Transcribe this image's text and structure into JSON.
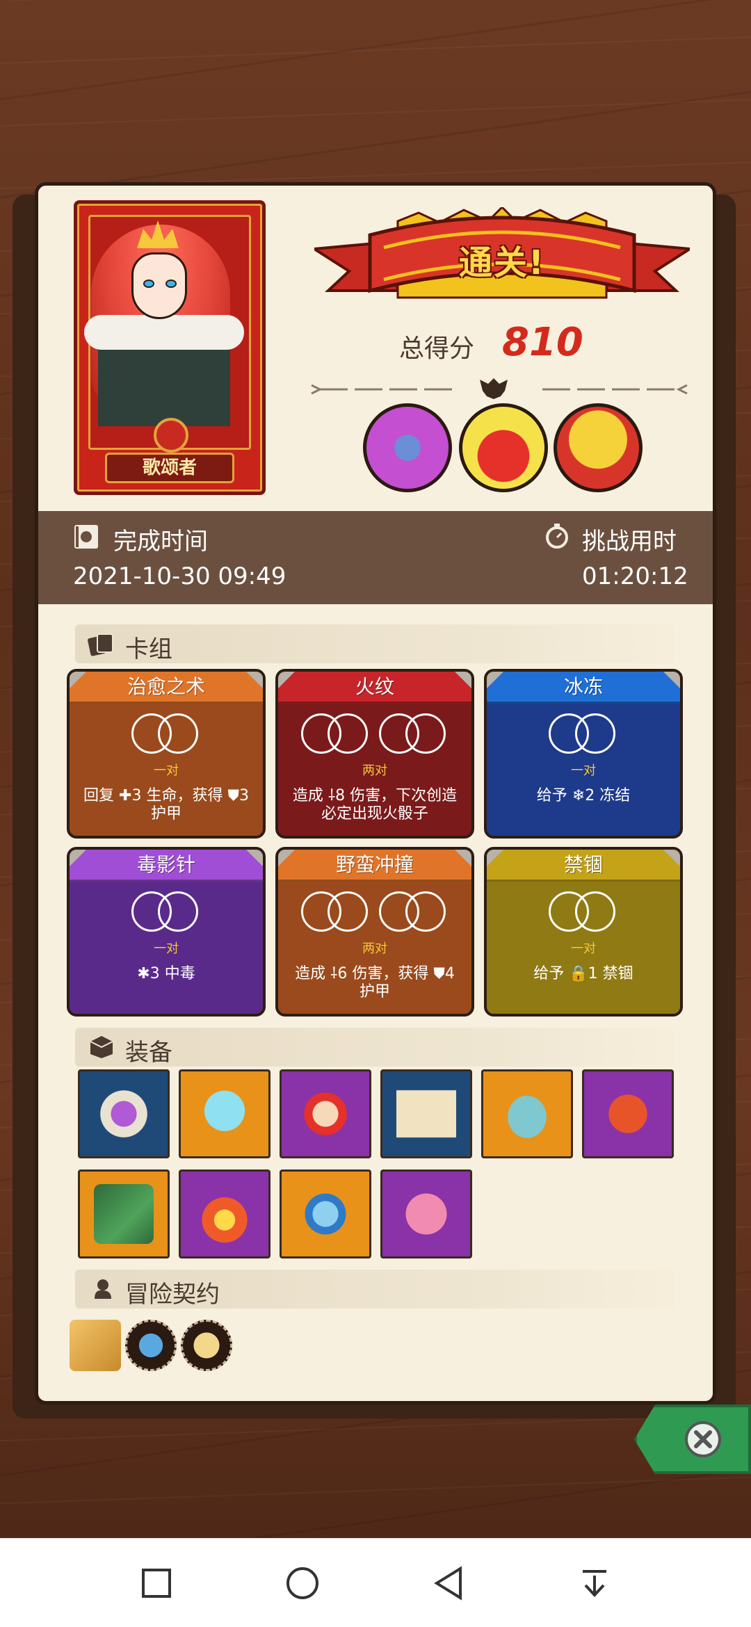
{
  "hero": {
    "name": "歌颂者"
  },
  "result": {
    "title": "通关!",
    "score_label": "总得分",
    "score": "810"
  },
  "enemies": [
    {
      "name": "purple-beast-icon",
      "color": "#c44fd0"
    },
    {
      "name": "red-demon-icon",
      "color": "#e5312a"
    },
    {
      "name": "gold-mask-icon",
      "color": "#f2c21d"
    }
  ],
  "time": {
    "complete_label": "完成时间",
    "complete_value": "2021-10-30 09:49",
    "challenge_label": "挑战用时",
    "challenge_value": "01:20:12"
  },
  "sections": {
    "deck": "卡组",
    "equipment": "装备",
    "contract": "冒险契约"
  },
  "cards": [
    {
      "title": "治愈之术",
      "pair": "一对",
      "desc": "回复 ✚3 生命，获得 ⛊3 护甲",
      "color": "#9a4a1c",
      "title_color": "#e0752a"
    },
    {
      "title": "火纹",
      "pair": "两对",
      "desc": "造成 ⸸8 伤害，下次创造必定出现火骰子",
      "color": "#7b1a1a",
      "title_color": "#c8252a"
    },
    {
      "title": "冰冻",
      "pair": "一对",
      "desc": "给予 ❄2 冻结",
      "color": "#1e3a8a",
      "title_color": "#1f6fd6"
    },
    {
      "title": "毒影针",
      "pair": "一对",
      "desc": "✱3 中毒",
      "color": "#5a2a8a",
      "title_color": "#a14ed6"
    },
    {
      "title": "野蛮冲撞",
      "pair": "两对",
      "desc": "造成 ⸸6 伤害，获得 ⛊4 护甲",
      "color": "#9a4a1c",
      "title_color": "#e0752a"
    },
    {
      "title": "禁锢",
      "pair": "一对",
      "desc": "给予 🔒1 禁锢",
      "color": "#8f7a14",
      "title_color": "#c4a318"
    }
  ],
  "equipment": [
    {
      "name": "skull-book-icon",
      "bg": "#1f4a78"
    },
    {
      "name": "ghost-slime-icon",
      "bg": "#e9921a"
    },
    {
      "name": "flame-mask-icon",
      "bg": "#8a32a8"
    },
    {
      "name": "fire-scroll-icon",
      "bg": "#1f4a78"
    },
    {
      "name": "teal-vase-icon",
      "bg": "#e9921a"
    },
    {
      "name": "spiked-bracer-icon",
      "bg": "#8a32a8"
    },
    {
      "name": "green-tome-icon",
      "bg": "#e9921a"
    },
    {
      "name": "fire-orb-icon",
      "bg": "#8a32a8"
    },
    {
      "name": "spiked-ball-icon",
      "bg": "#e9921a"
    },
    {
      "name": "spotted-shell-icon",
      "bg": "#8a32a8"
    }
  ],
  "contracts": [
    {
      "name": "scroll-contract-icon"
    },
    {
      "name": "blue-tag-contract-icon"
    },
    {
      "name": "horn-contract-icon"
    }
  ],
  "colors": {
    "panel": "#f8f0de",
    "timebar": "#6b5040",
    "score": "#d42a1e"
  }
}
